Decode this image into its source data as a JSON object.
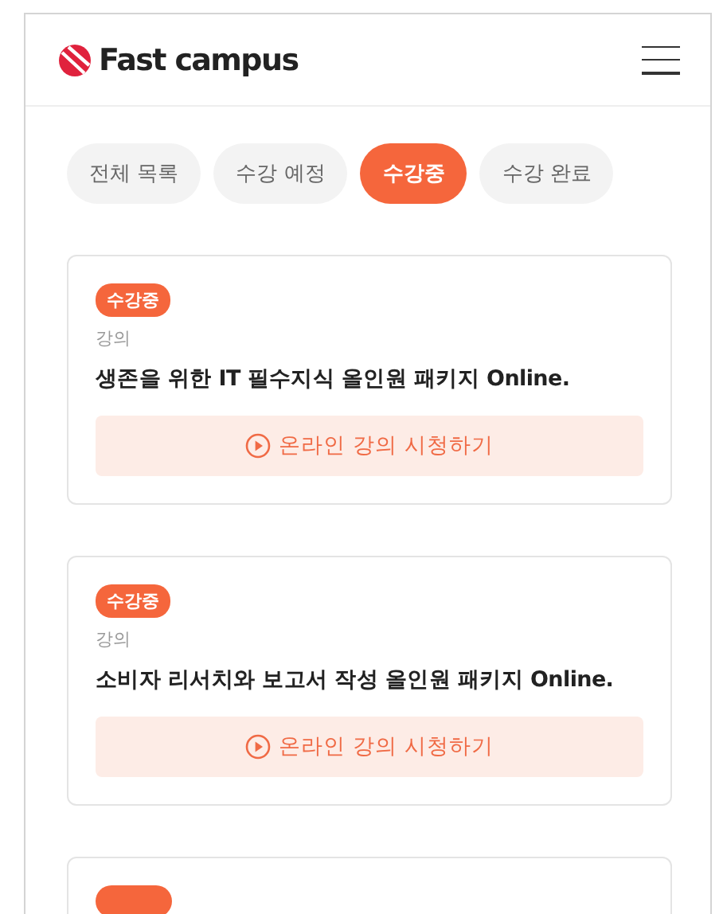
{
  "header": {
    "logo_text": "Fast campus"
  },
  "tabs": [
    {
      "label": "전체 목록",
      "selected": false
    },
    {
      "label": "수강 예정",
      "selected": false
    },
    {
      "label": "수강중",
      "selected": true
    },
    {
      "label": "수강 완료",
      "selected": false
    }
  ],
  "courses": [
    {
      "badge": "수강중",
      "category": "강의",
      "title": "생존을 위한 IT 필수지식 올인원 패키지 Online.",
      "action": "온라인 강의 시청하기"
    },
    {
      "badge": "수강중",
      "category": "강의",
      "title": "소비자 리서치와 보고서 작성 올인원 패키지 Online.",
      "action": "온라인 강의 시청하기"
    }
  ]
}
